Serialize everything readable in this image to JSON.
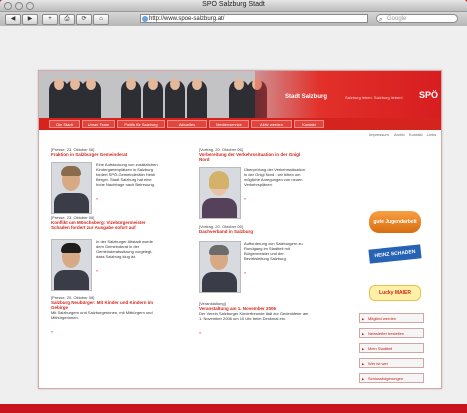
{
  "browser": {
    "window_title": "SPÖ Salzburg Stadt",
    "url": "http://www.spoe-salzburg.at/",
    "search_placeholder": "Google",
    "buttons": [
      "◀",
      "▶",
      "+",
      "⎙",
      "⟳",
      "⌂"
    ]
  },
  "site": {
    "brand": "Stadt Salzburg",
    "tagline": "Salzburg leben. Salzburg lieben!",
    "logo": "SPÖ",
    "nav": [
      "Die Stadt",
      "Unser Team",
      "Politik für Salzburg",
      "Aktuelles",
      "Medienservice",
      "Aktiv werden",
      "Kontakt"
    ],
    "subnav": [
      "Impressum",
      "Archiv",
      "Kontakt",
      "Links"
    ]
  },
  "articles_left": [
    {
      "date": "[Presse, 23. Oktober 06]",
      "headline": "Fraktion in Salzburger Gemeinderat",
      "body": "Eine Aufstockung von zusätzlichen Kindergartenplätzen in Salzburg fordert SPÖ-Gemeinderätin Heidi Berger. Stadt Salzburg hat eine hohe Nachfrage nach Betreuung.",
      "more": "»"
    },
    {
      "date": "[Presse, 23. Oktober 06]",
      "headline": "Konflikt um Mönchsberg: Vizebürgermeister Schaden fordert zur Ausgabe sofort auf",
      "body": "In der Salzburger Altstadt wurde dem Gemeinderat in der Gemeinderatssitzung vorgelegt, dass Salzburg klug ist.",
      "more": "»"
    },
    {
      "date": "[Presse, 20. Oktober 06]",
      "headline": "Salzburg Neubürger: Mit Kinder und Kindern im Gebirge",
      "body": "Mit Salzburgern und Salzburgerinnen, mit Mitbürgern und Mitbürgerinnen.",
      "more": "»"
    }
  ],
  "articles_right": [
    {
      "date": "[Vortrag, 20. Oktober 06]",
      "headline": "Vorbereitung der Verkehrssituation in der Gnigl Nord",
      "body": "Überprüfung der Verkehrssituation in der Gnigl Nord - wir bitten um mögliche Anregungen von neuen Verkehrsplänen.",
      "more": "»"
    },
    {
      "date": "[Vortrag, 20. Oktober 06]",
      "headline": "Dachverband in Salzburg",
      "body": "Aufforderung von Salzburgern zu Rundgang im Stadtteil mit Bürgermeister und der Bezirksleitung Salzburg.",
      "more": "»"
    },
    {
      "date": "[Veranstaltung]",
      "headline": "Veranstaltung am 1. November 2006",
      "body": "Der Verein Salzburger Kinderfreunde lädt zur Gedenkfeier am 1. November 2006 um 10 Uhr beim Denkmal ein.",
      "more": "»"
    }
  ],
  "sidebar": {
    "logos": [
      "gute Jugendarbeit",
      "HEINZ SCHADEN",
      "Lucky MAIER"
    ],
    "buttons": [
      "Mitglied werden",
      "Newsletter bestellen",
      "Mein Stadtteil",
      "Wer ist wer",
      "Schlussfolgerungen"
    ]
  },
  "colors": {
    "brand_red": "#d5241e",
    "headline_red": "#d1261d",
    "page_background": "#c8141c"
  }
}
